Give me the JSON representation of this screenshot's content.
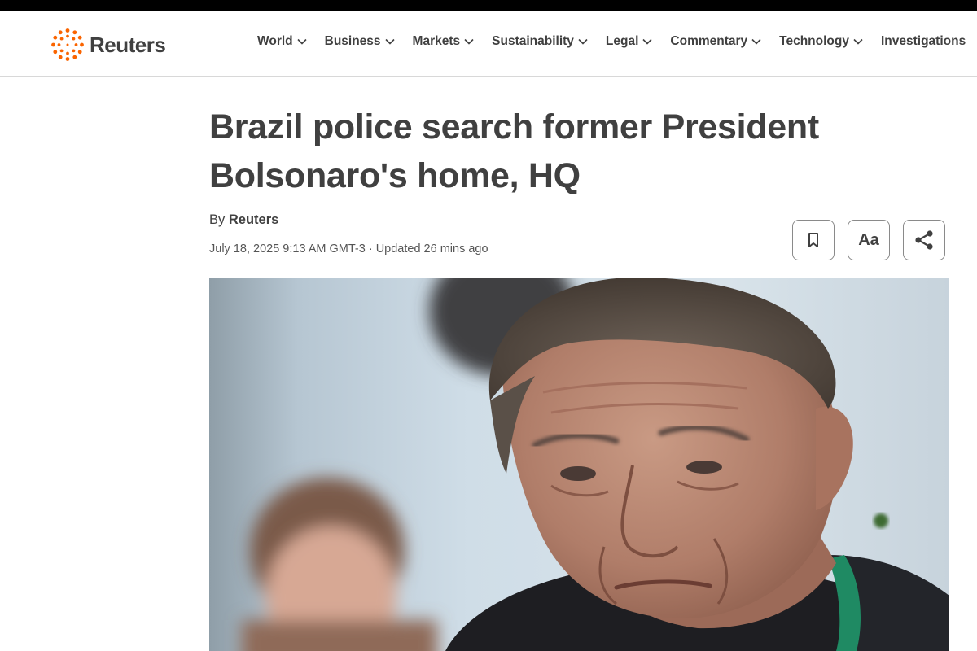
{
  "brand": {
    "name": "Reuters",
    "logo_icon": "reuters-dots-logo",
    "accent": "#fa6400"
  },
  "nav": {
    "items": [
      {
        "label": "World"
      },
      {
        "label": "Business"
      },
      {
        "label": "Markets"
      },
      {
        "label": "Sustainability"
      },
      {
        "label": "Legal"
      },
      {
        "label": "Commentary"
      },
      {
        "label": "Technology"
      },
      {
        "label": "Investigations"
      }
    ],
    "chevron_icon": "chevron-down-icon"
  },
  "article": {
    "headline": "Brazil police search former President Bolsonaro's home, HQ",
    "byline_prefix": "By",
    "author": "Reuters",
    "dateline": "July 18, 2025 9:13 AM GMT-3 · Updated 26 mins ago",
    "actions": {
      "bookmark_icon": "bookmark-icon",
      "text_size_label": "Aa",
      "share_icon": "share-icon"
    },
    "image_alt": "Photo of Jair Bolsonaro"
  }
}
